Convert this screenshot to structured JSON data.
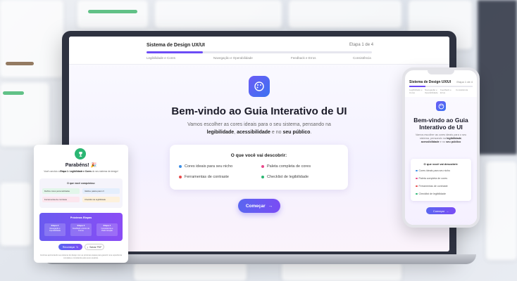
{
  "laptop": {
    "title": "Sistema de Design UX/UI",
    "step": "Etapa 1 de 4",
    "progress_fraction": 0.25,
    "steps": [
      "Legibilidade e Cores",
      "Navegação e Operabilidade",
      "Feedback e Erros",
      "Consistência"
    ],
    "hero_title": "Bem-vindo ao Guia Interativo de UI",
    "hero_desc_line1": "Vamos escolher as cores ideais para o seu sistema, pensando na",
    "hero_desc_b1": "legibilidade",
    "hero_desc_sep1": ",",
    "hero_desc_b2": "acessibilidade",
    "hero_desc_mid": "e no",
    "hero_desc_b3": "seu público",
    "hero_desc_end": ".",
    "discover_title": "O que você vai descobrir:",
    "discover_items": [
      {
        "label": "Cores ideais para seu nicho",
        "color": "#3a8ee6"
      },
      {
        "label": "Paleta completa de cores",
        "color": "#e8488a"
      },
      {
        "label": "Ferramentas de contraste",
        "color": "#e84a4a"
      },
      {
        "label": "Checklist de legibilidade",
        "color": "#2bb673"
      }
    ],
    "start_button": "Começar",
    "start_arrow": "→",
    "palette_icon": "palette-icon"
  },
  "phone": {
    "title": "Sistema de Design UX/UI",
    "step": "Etapa 1 de 4",
    "steps": [
      "Legibilidade e Cores",
      "Navegação e Operabilidade",
      "Feedback e Erros",
      "Consistência"
    ],
    "hero_title_l1": "Bem-vindo ao Guia",
    "hero_title_l2": "Interativo de UI",
    "desc_l1": "Vamos escolher as cores ideais para o seu sistema, pensando na",
    "desc_b1": "legibilidade",
    "desc_sep": ",",
    "desc_b2": "acessibilidade",
    "desc_mid": "e no",
    "desc_b3": "seu público",
    "discover_title": "O que você vai descobrir:",
    "discover_items": [
      {
        "label": "Cores ideais para seu nicho",
        "color": "#3a8ee6"
      },
      {
        "label": "Paleta completa de cores",
        "color": "#e8488a"
      },
      {
        "label": "Ferramentas de contraste",
        "color": "#e84a4a"
      },
      {
        "label": "Checklist de legibilidade",
        "color": "#2bb673"
      }
    ],
    "start_button": "Começar",
    "start_arrow": "→"
  },
  "congrats": {
    "title": "Parabéns! 🎉",
    "sub_pre": "Você concluiu a",
    "sub_b": "Etapa 1: Legibilidade e Cores",
    "sub_post": "do seu sistema de design!",
    "box_title": "O que você conquistou:",
    "chips": [
      {
        "label": "Definiu cores personalizadas",
        "bg": "#e2f6ea"
      },
      {
        "label": "Validou paleta para UI",
        "bg": "#e4eefc"
      },
      {
        "label": "Ferramentas de contraste",
        "bg": "#fce6ee"
      },
      {
        "label": "Checklist de legibilidade",
        "bg": "#fdf1dc"
      }
    ],
    "next_title": "Próximas Etapas",
    "next_cards": [
      {
        "step": "Etapa 2",
        "label": "Navegação e Operabilidade"
      },
      {
        "step": "Etapa 3",
        "label": "Feedback e Erros de Forma"
      },
      {
        "step": "Etapa 4",
        "label": "Consistência e Padronização"
      }
    ],
    "btn_primary": "Recomeçar",
    "btn_secondary": "Salvar PDF",
    "footer": "Continue aprimorando seu sistema de design com as próximas etapas para garantir uma experiência completa e consistente para seus usuários."
  }
}
